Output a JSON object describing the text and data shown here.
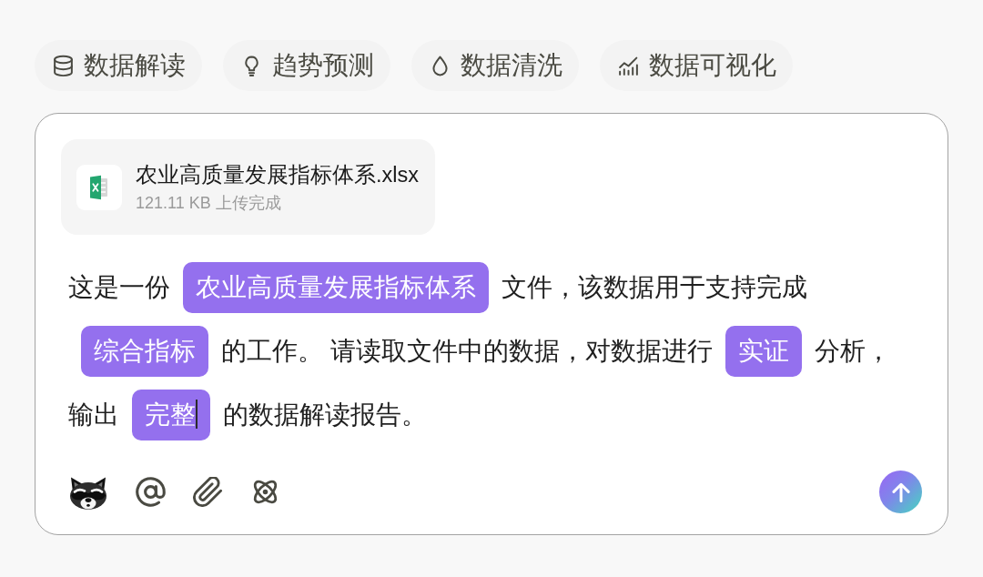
{
  "suggestions": [
    {
      "label": "数据解读"
    },
    {
      "label": "趋势预测"
    },
    {
      "label": "数据清洗"
    },
    {
      "label": "数据可视化"
    }
  ],
  "composer": {
    "attachment": {
      "file_name": "农业高质量发展指标体系.xlsx",
      "status": "121.11 KB 上传完成"
    },
    "message": [
      {
        "kind": "text",
        "text": "这是一份",
        "caret": false
      },
      {
        "kind": "tag",
        "text": "农业高质量发展指标体系",
        "caret": false
      },
      {
        "kind": "text",
        "text": "文件，该数据用于支持完成",
        "caret": false
      },
      {
        "kind": "tag",
        "text": "综合指标",
        "caret": false
      },
      {
        "kind": "text",
        "text": "的工作。 请读取文件中的数据，对数据进行",
        "caret": false
      },
      {
        "kind": "tag",
        "text": "实证",
        "caret": false
      },
      {
        "kind": "text",
        "text": "分析，",
        "caret": false
      },
      {
        "kind": "text",
        "text": "输出",
        "caret": false
      },
      {
        "kind": "tag",
        "text": "完整",
        "caret": true
      },
      {
        "kind": "text",
        "text": "的数据解读报告。",
        "caret": false
      }
    ]
  }
}
